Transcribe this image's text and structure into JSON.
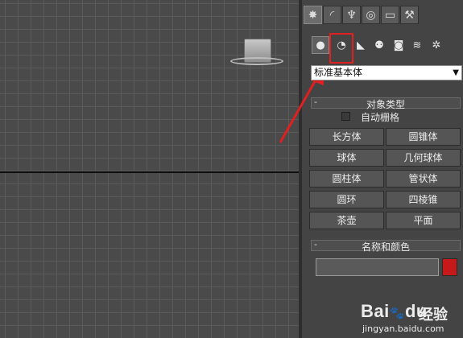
{
  "panel": {
    "tabs": [
      {
        "icon": "sun-icon",
        "glyph": "✸",
        "active": true
      },
      {
        "icon": "modify-curve-icon",
        "glyph": "◜",
        "active": false
      },
      {
        "icon": "hierarchy-icon",
        "glyph": "♆",
        "active": false
      },
      {
        "icon": "motion-icon",
        "glyph": "◎",
        "active": false
      },
      {
        "icon": "display-monitor-icon",
        "glyph": "▭",
        "active": false
      },
      {
        "icon": "hammer-icon",
        "glyph": "⚒",
        "active": false
      }
    ],
    "sub_buttons": [
      {
        "icon": "geometry-sphere-icon",
        "glyph": "●",
        "active": true
      },
      {
        "icon": "shapes-icon",
        "glyph": "◔",
        "active": false
      },
      {
        "icon": "lights-icon",
        "glyph": "◣",
        "active": false
      },
      {
        "icon": "cameras-icon",
        "glyph": "⚉",
        "active": false
      },
      {
        "icon": "helpers-icon",
        "glyph": "◙",
        "active": false
      },
      {
        "icon": "space-warps-icon",
        "glyph": "≋",
        "active": false
      },
      {
        "icon": "systems-icon",
        "glyph": "✲",
        "active": false
      }
    ],
    "category_select": {
      "value": "标准基本体"
    },
    "object_type": {
      "title": "对象类型",
      "toggle": "-",
      "autogrid_label": "自动栅格",
      "buttons": [
        "长方体",
        "圆锥体",
        "球体",
        "几何球体",
        "圆柱体",
        "管状体",
        "圆环",
        "四棱锥",
        "茶壶",
        "平面"
      ]
    },
    "name_color": {
      "title": "名称和颜色",
      "toggle": "-",
      "name_value": "",
      "color": "#c61a1a"
    }
  },
  "watermark": {
    "logo": "Bai",
    "logo2": "du",
    "product": "经验",
    "url": "jingyan.baidu.com"
  },
  "colors": {
    "highlight": "#e02020",
    "viewport_bg": "#4a4a4a",
    "panel_bg": "#444444"
  }
}
